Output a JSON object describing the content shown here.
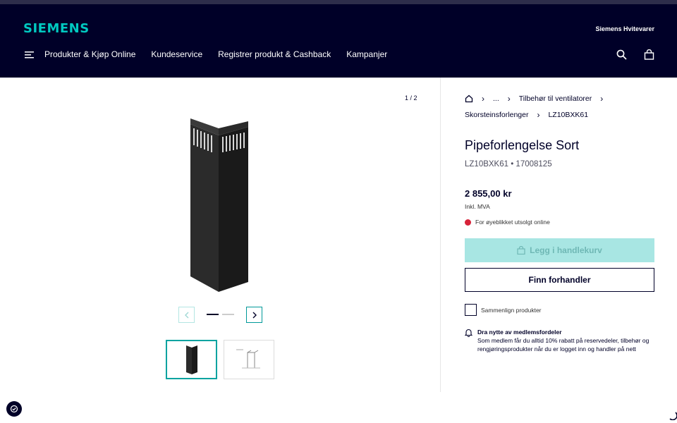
{
  "header": {
    "logo": "SIEMENS",
    "brand_link": "Siemens Hvitevarer",
    "nav": [
      "Produkter & Kjøp Online",
      "Kundeservice",
      "Registrer produkt & Cashback",
      "Kampanjer"
    ],
    "icons": [
      "menu-icon",
      "search-icon",
      "cart-icon"
    ]
  },
  "gallery": {
    "counter": "1 / 2",
    "prev_icon": "chevron-left-icon",
    "next_icon": "chevron-right-icon",
    "thumbnails": 2
  },
  "breadcrumb": {
    "home_icon": "home-icon",
    "ellipsis": "...",
    "level1": "Tilbehør til ventilatorer",
    "level2": "Skorsteinsforlenger",
    "level3": "LZ10BXK61"
  },
  "product": {
    "title": "Pipeforlengelse Sort",
    "sku": "LZ10BXK61 • 17008125",
    "price": "2 855,00 kr",
    "vat": "Inkl. MVA",
    "stock": "For øyeblikket utsolgt online",
    "add_to_cart": "Legg i handlekurv",
    "find_dealer": "Finn forhandler",
    "compare": "Sammenlign produkter"
  },
  "member": {
    "title": "Dra nytte av medlemsfordeler",
    "text": "Som medlem får du alltid 10% rabatt på reservedeler, tilbehør og rengjøringsprodukter når du er logget inn og handler på nett"
  },
  "colors": {
    "header_bg": "#000028",
    "accent": "#00c9c1",
    "cart_button": "#a8e6e3",
    "stock_red": "#d72339"
  }
}
